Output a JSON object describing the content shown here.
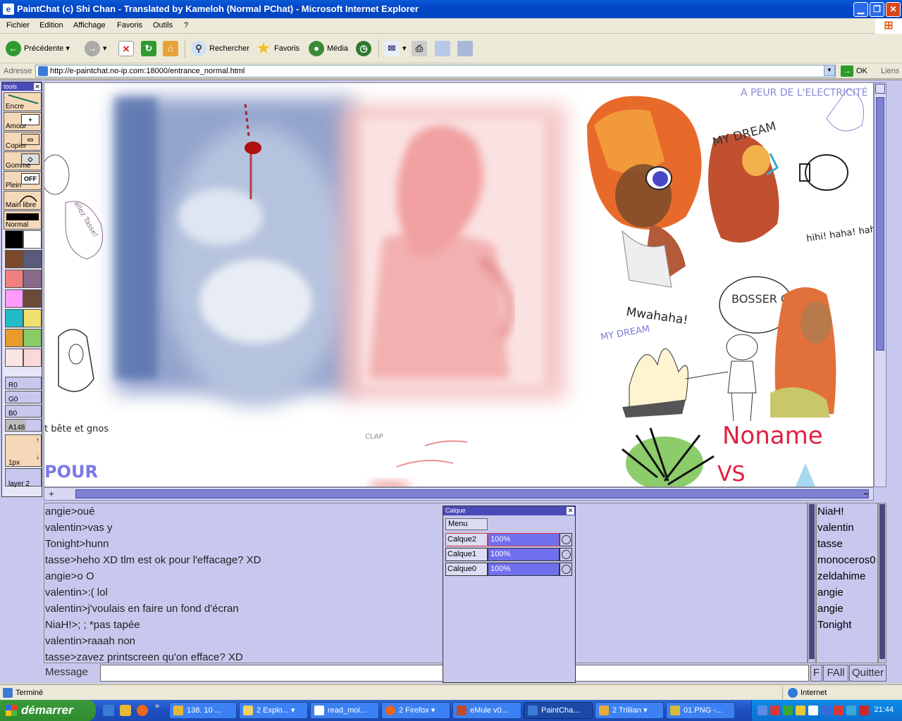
{
  "window": {
    "title": "PaintChat (c) Shi Chan - Translated by Kameloh (Normal PChat) - Microsoft Internet Explorer",
    "minimize": "0",
    "maximize": "1",
    "close": "r"
  },
  "menu": [
    "Fichier",
    "Edition",
    "Affichage",
    "Favoris",
    "Outils",
    "?"
  ],
  "toolbar": {
    "back": "Précédente",
    "search": "Rechercher",
    "favorites": "Favoris",
    "media": "Média"
  },
  "address": {
    "label": "Adresse",
    "url": "http://e-paintchat.no-ip.com:18000/entrance_normal.html",
    "go": "OK",
    "links": "Liens"
  },
  "tools": {
    "title": "tools",
    "items": [
      "Encre",
      "Amour",
      "Copier",
      "Gomme",
      "Plein",
      "Main libre"
    ],
    "mode": "Normal",
    "off_label": "OFF",
    "r": "R0",
    "g": "G0",
    "b": "B0",
    "a": "A148",
    "size": "1px",
    "layer": "layer 2",
    "palette": [
      "#000000",
      "#ffffff",
      "#7a4a2a",
      "#5a5a7a",
      "#f08080",
      "#8a6a8a",
      "#ff99ff",
      "#6a4a3a",
      "#22bbc8",
      "#f0e070",
      "#e89a2a",
      "#88cc66",
      "#fbe4e4",
      "#f8d8d8"
    ]
  },
  "canvas": {
    "texts": {
      "peur": "A PEUR DE L'ELECTRICITÉ",
      "dream1": "MY DREAM",
      "hihi": "hihi! haha! haha!",
      "mwah": "Mwahaha!",
      "bosser": "BOSSER CÉMAL",
      "dream2": "MY DREAM",
      "noname": "Noname",
      "vs": "VS",
      "allez": "allez Tasse!",
      "bete": "t bête et gnos",
      "clap": "CLAP",
      "pour": "POUR"
    }
  },
  "chat": {
    "lines": [
      "angie>oué",
      "valentin>vas y",
      "Tonight>hunn",
      "tasse>heho XD tlm est ok pour l'effacage? XD",
      "angie>o   O",
      "valentin>:( lol",
      "valentin>j'voulais en faire un fond d'écran",
      "NiaH!>;  ; *pas tapée",
      "valentin>raaah non",
      "tasse>zavez printscreen qu'on efface? XD"
    ],
    "message_label": "Message",
    "btn_f": "F",
    "btn_fall": "FAll",
    "btn_quit": "Quitter"
  },
  "users": [
    "NiaH!",
    "valentin",
    "tasse",
    "monoceros0",
    "zeldahime",
    "angie",
    "angie",
    "Tonight"
  ],
  "calque": {
    "title": "Calque",
    "menu": "Menu",
    "layers": [
      {
        "name": "Calque2",
        "opacity": "100%"
      },
      {
        "name": "Calque1",
        "opacity": "100%"
      },
      {
        "name": "Calque0",
        "opacity": "100%"
      }
    ]
  },
  "status": {
    "text": "Terminé",
    "zone": "Internet"
  },
  "taskbar": {
    "start": "démarrer",
    "tasks": [
      "138. 10 ...",
      "2 Explo...",
      "read_moi...",
      "2 Firefox",
      "eMule v0...",
      "PaintCha...",
      "2 Trillian",
      "01.PNG -..."
    ],
    "clock": "21:44"
  }
}
